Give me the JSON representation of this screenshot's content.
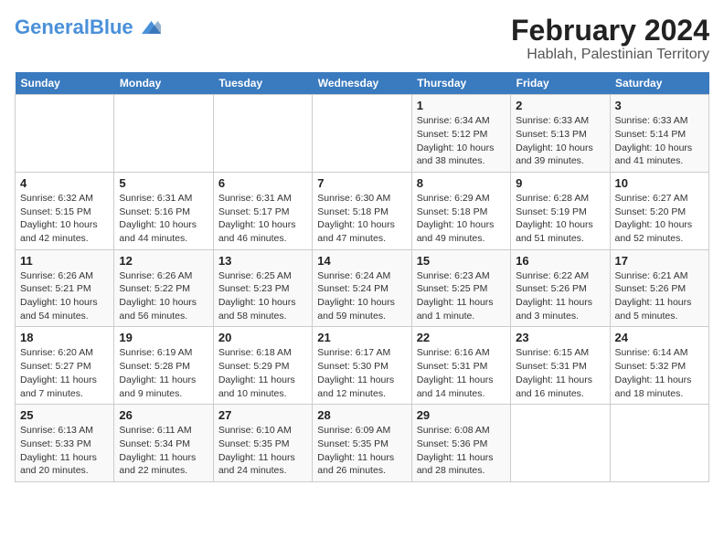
{
  "header": {
    "logo_general": "General",
    "logo_blue": "Blue",
    "title": "February 2024",
    "subtitle": "Hablah, Palestinian Territory"
  },
  "weekdays": [
    "Sunday",
    "Monday",
    "Tuesday",
    "Wednesday",
    "Thursday",
    "Friday",
    "Saturday"
  ],
  "weeks": [
    [
      {
        "day": "",
        "info": ""
      },
      {
        "day": "",
        "info": ""
      },
      {
        "day": "",
        "info": ""
      },
      {
        "day": "",
        "info": ""
      },
      {
        "day": "1",
        "info": "Sunrise: 6:34 AM\nSunset: 5:12 PM\nDaylight: 10 hours\nand 38 minutes."
      },
      {
        "day": "2",
        "info": "Sunrise: 6:33 AM\nSunset: 5:13 PM\nDaylight: 10 hours\nand 39 minutes."
      },
      {
        "day": "3",
        "info": "Sunrise: 6:33 AM\nSunset: 5:14 PM\nDaylight: 10 hours\nand 41 minutes."
      }
    ],
    [
      {
        "day": "4",
        "info": "Sunrise: 6:32 AM\nSunset: 5:15 PM\nDaylight: 10 hours\nand 42 minutes."
      },
      {
        "day": "5",
        "info": "Sunrise: 6:31 AM\nSunset: 5:16 PM\nDaylight: 10 hours\nand 44 minutes."
      },
      {
        "day": "6",
        "info": "Sunrise: 6:31 AM\nSunset: 5:17 PM\nDaylight: 10 hours\nand 46 minutes."
      },
      {
        "day": "7",
        "info": "Sunrise: 6:30 AM\nSunset: 5:18 PM\nDaylight: 10 hours\nand 47 minutes."
      },
      {
        "day": "8",
        "info": "Sunrise: 6:29 AM\nSunset: 5:18 PM\nDaylight: 10 hours\nand 49 minutes."
      },
      {
        "day": "9",
        "info": "Sunrise: 6:28 AM\nSunset: 5:19 PM\nDaylight: 10 hours\nand 51 minutes."
      },
      {
        "day": "10",
        "info": "Sunrise: 6:27 AM\nSunset: 5:20 PM\nDaylight: 10 hours\nand 52 minutes."
      }
    ],
    [
      {
        "day": "11",
        "info": "Sunrise: 6:26 AM\nSunset: 5:21 PM\nDaylight: 10 hours\nand 54 minutes."
      },
      {
        "day": "12",
        "info": "Sunrise: 6:26 AM\nSunset: 5:22 PM\nDaylight: 10 hours\nand 56 minutes."
      },
      {
        "day": "13",
        "info": "Sunrise: 6:25 AM\nSunset: 5:23 PM\nDaylight: 10 hours\nand 58 minutes."
      },
      {
        "day": "14",
        "info": "Sunrise: 6:24 AM\nSunset: 5:24 PM\nDaylight: 10 hours\nand 59 minutes."
      },
      {
        "day": "15",
        "info": "Sunrise: 6:23 AM\nSunset: 5:25 PM\nDaylight: 11 hours\nand 1 minute."
      },
      {
        "day": "16",
        "info": "Sunrise: 6:22 AM\nSunset: 5:26 PM\nDaylight: 11 hours\nand 3 minutes."
      },
      {
        "day": "17",
        "info": "Sunrise: 6:21 AM\nSunset: 5:26 PM\nDaylight: 11 hours\nand 5 minutes."
      }
    ],
    [
      {
        "day": "18",
        "info": "Sunrise: 6:20 AM\nSunset: 5:27 PM\nDaylight: 11 hours\nand 7 minutes."
      },
      {
        "day": "19",
        "info": "Sunrise: 6:19 AM\nSunset: 5:28 PM\nDaylight: 11 hours\nand 9 minutes."
      },
      {
        "day": "20",
        "info": "Sunrise: 6:18 AM\nSunset: 5:29 PM\nDaylight: 11 hours\nand 10 minutes."
      },
      {
        "day": "21",
        "info": "Sunrise: 6:17 AM\nSunset: 5:30 PM\nDaylight: 11 hours\nand 12 minutes."
      },
      {
        "day": "22",
        "info": "Sunrise: 6:16 AM\nSunset: 5:31 PM\nDaylight: 11 hours\nand 14 minutes."
      },
      {
        "day": "23",
        "info": "Sunrise: 6:15 AM\nSunset: 5:31 PM\nDaylight: 11 hours\nand 16 minutes."
      },
      {
        "day": "24",
        "info": "Sunrise: 6:14 AM\nSunset: 5:32 PM\nDaylight: 11 hours\nand 18 minutes."
      }
    ],
    [
      {
        "day": "25",
        "info": "Sunrise: 6:13 AM\nSunset: 5:33 PM\nDaylight: 11 hours\nand 20 minutes."
      },
      {
        "day": "26",
        "info": "Sunrise: 6:11 AM\nSunset: 5:34 PM\nDaylight: 11 hours\nand 22 minutes."
      },
      {
        "day": "27",
        "info": "Sunrise: 6:10 AM\nSunset: 5:35 PM\nDaylight: 11 hours\nand 24 minutes."
      },
      {
        "day": "28",
        "info": "Sunrise: 6:09 AM\nSunset: 5:35 PM\nDaylight: 11 hours\nand 26 minutes."
      },
      {
        "day": "29",
        "info": "Sunrise: 6:08 AM\nSunset: 5:36 PM\nDaylight: 11 hours\nand 28 minutes."
      },
      {
        "day": "",
        "info": ""
      },
      {
        "day": "",
        "info": ""
      }
    ]
  ]
}
